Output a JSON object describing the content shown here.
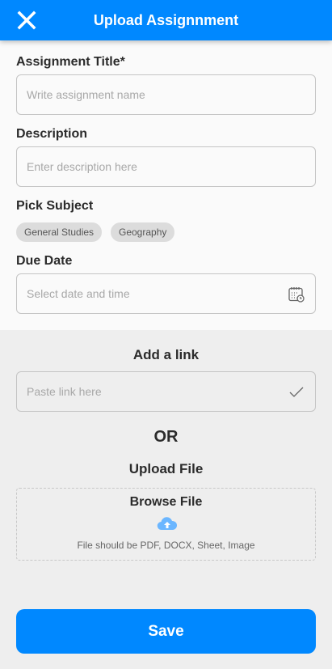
{
  "header": {
    "title": "Upload Assignnment",
    "close_icon": "close-icon",
    "color": "#0088ff"
  },
  "form": {
    "title_label": "Assignment Title*",
    "title_placeholder": "Write assignment name",
    "description_label": "Description",
    "description_placeholder": "Enter description here",
    "subject_label": "Pick Subject",
    "subjects": [
      "General Studies",
      "Geography"
    ],
    "due_label": "Due Date",
    "due_placeholder": "Select date and time",
    "due_icon": "calendar-clock-icon"
  },
  "link": {
    "heading": "Add a link",
    "placeholder": "Paste link here",
    "icon": "check-icon"
  },
  "or_label": "OR",
  "upload": {
    "heading": "Upload File",
    "browse": "Browse File",
    "icon": "cloud-upload-icon",
    "hint": "File should be PDF, DOCX, Sheet, Image"
  },
  "save_label": "Save"
}
